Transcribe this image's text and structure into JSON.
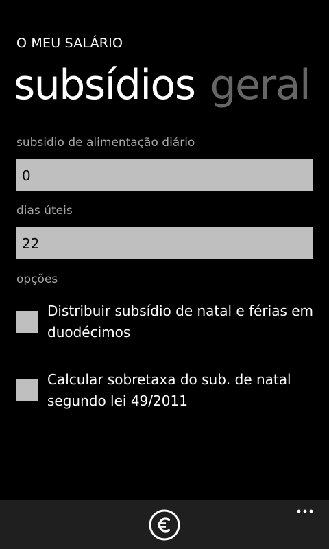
{
  "app": {
    "title": "O MEU SALÁRIO"
  },
  "pivot": {
    "active_label": "subsídios",
    "next_label": "geral"
  },
  "form": {
    "meal_allowance": {
      "label": "subsidio de alimentação diário",
      "value": "0"
    },
    "working_days": {
      "label": "dias úteis",
      "value": "22"
    },
    "options_label": "opções",
    "options": [
      {
        "label": "Distribuir subsídio de natal e férias em duodécimos",
        "checked": false
      },
      {
        "label": "Calcular sobretaxa do sub. de natal segundo lei 49/2011",
        "checked": false
      }
    ]
  },
  "appbar": {
    "button_icon": "euro-icon",
    "more_icon": "ellipsis-icon"
  },
  "colors": {
    "background": "#000000",
    "textbox": "#bfbfbf",
    "label": "#a6a6a6",
    "inactive_pivot": "#666666",
    "appbar": "#1f1f1f"
  }
}
